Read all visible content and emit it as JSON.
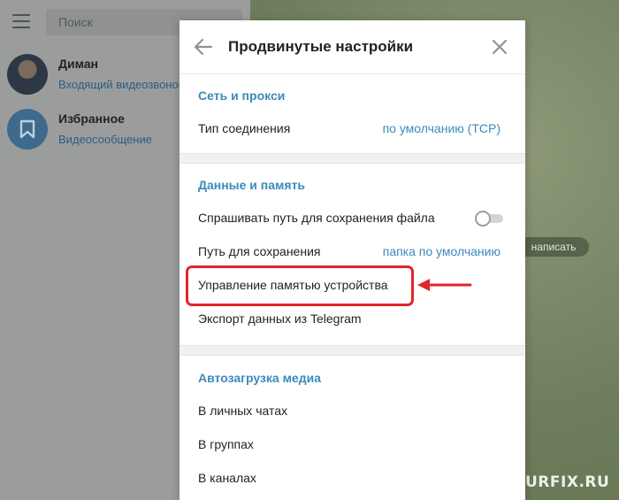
{
  "sidebar": {
    "search_placeholder": "Поиск",
    "chats": [
      {
        "name": "Диман",
        "preview": "Входящий видеозвонок"
      },
      {
        "name": "Избранное",
        "preview": "Видеосообщение"
      }
    ]
  },
  "chat_area": {
    "write_pill": "написать"
  },
  "modal": {
    "title": "Продвинутые настройки",
    "sections": [
      {
        "title": "Сеть и прокси",
        "rows": [
          {
            "label": "Тип соединения",
            "value": "по умолчанию (TCP)"
          }
        ]
      },
      {
        "title": "Данные и память",
        "rows": [
          {
            "label": "Спрашивать путь для сохранения файла",
            "toggle": false
          },
          {
            "label": "Путь для сохранения",
            "value": "папка по умолчанию"
          },
          {
            "label": "Управление памятью устройства"
          },
          {
            "label": "Экспорт данных из Telegram"
          }
        ]
      },
      {
        "title": "Автозагрузка медиа",
        "rows": [
          {
            "label": "В личных чатах"
          },
          {
            "label": "В группах"
          },
          {
            "label": "В каналах"
          }
        ]
      }
    ]
  },
  "watermark": "URFIX.RU",
  "colors": {
    "accent": "#3a8bbb",
    "highlight": "#e0262b"
  }
}
